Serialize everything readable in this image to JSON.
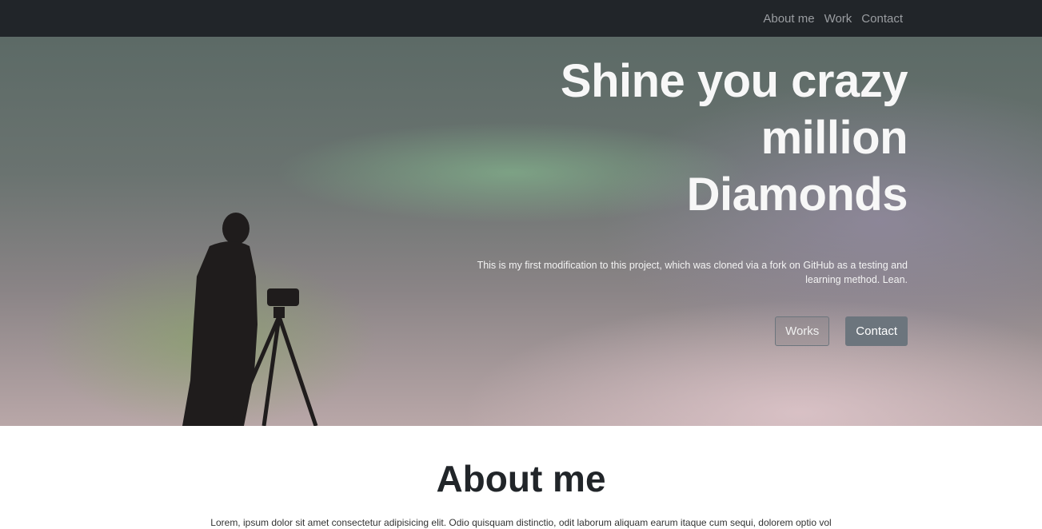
{
  "nav": {
    "items": [
      {
        "label": "About me"
      },
      {
        "label": "Work"
      },
      {
        "label": "Contact"
      }
    ]
  },
  "hero": {
    "title_lines": [
      "Shine you crazy",
      "million",
      "Diamonds"
    ],
    "subtitle_line1": "This is my first modification to this project, which was cloned via a fork on GitHub as a testing and",
    "subtitle_line2": "learning method. Lean.",
    "buttons": {
      "works": "Works",
      "contact": "Contact"
    }
  },
  "about": {
    "title": "About me",
    "text": "Lorem, ipsum dolor sit amet consectetur adipisicing elit. Odio quisquam distinctio, odit laborum aliquam earum itaque cum sequi, dolorem optio vol"
  },
  "colors": {
    "navbar_bg": "#212529",
    "nav_link": "#9a9da1",
    "button_secondary": "#6c757d",
    "heading": "#212529"
  }
}
